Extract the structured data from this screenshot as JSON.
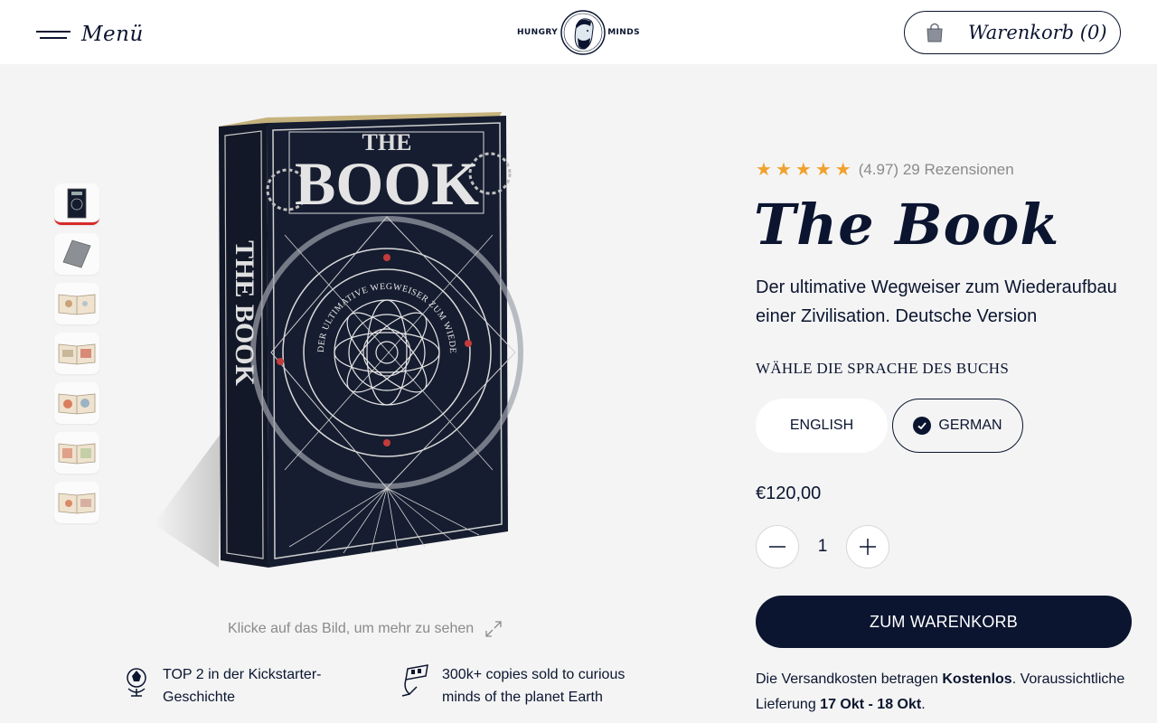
{
  "header": {
    "menu_label": "Menü",
    "logo_left": "HUNGRY",
    "logo_right": "MINDS",
    "cart_label": "Warenkorb (0)"
  },
  "thumbnails": [
    {
      "name": "cover"
    },
    {
      "name": "back"
    },
    {
      "name": "page-1"
    },
    {
      "name": "page-2"
    },
    {
      "name": "page-3"
    },
    {
      "name": "page-4"
    },
    {
      "name": "page-5"
    }
  ],
  "gallery": {
    "book_cover_lines": [
      "THE",
      "BOOK"
    ],
    "book_spine": "THE BOOK",
    "book_ring_text": "DER ULTIMATIVE WEGWEISER ZUM WIEDERAUFBAU EINER ZIVILISATION",
    "hint": "Klicke auf das Bild, um mehr zu sehen"
  },
  "features": [
    {
      "icon": "rocket-trophy-icon",
      "line1": "TOP 2 in der Kickstarter-",
      "line2": "Geschichte"
    },
    {
      "icon": "book-stack-icon",
      "line1": "300k+ copies sold to curious",
      "line2": "minds of the planet Earth"
    }
  ],
  "product": {
    "rating": 4.97,
    "rating_text": "(4.97) 29 Rezensionen",
    "title": "The Book",
    "subtitle": "Der ultimative Wegweiser zum Wiederaufbau einer Zivilisation. Deutsche Version",
    "language_heading": "WÄHLE DIE SPRACHE DES BUCHS",
    "languages": [
      {
        "label": "ENGLISH",
        "selected": false
      },
      {
        "label": "GERMAN",
        "selected": true
      }
    ],
    "price": "€120,00",
    "quantity": "1",
    "add_to_cart": "ZUM WARENKORB",
    "shipping": {
      "prefix": "Die Versandkosten betragen ",
      "cost": "Kostenlos",
      "middle": ". Voraussichtliche Lieferung ",
      "date": "17 Okt - 18 Okt",
      "suffix": "."
    }
  },
  "colors": {
    "navy": "#0b1530",
    "star": "#f0a22e",
    "background": "#f4f4f4",
    "active_thumb": "#d62a2a"
  }
}
